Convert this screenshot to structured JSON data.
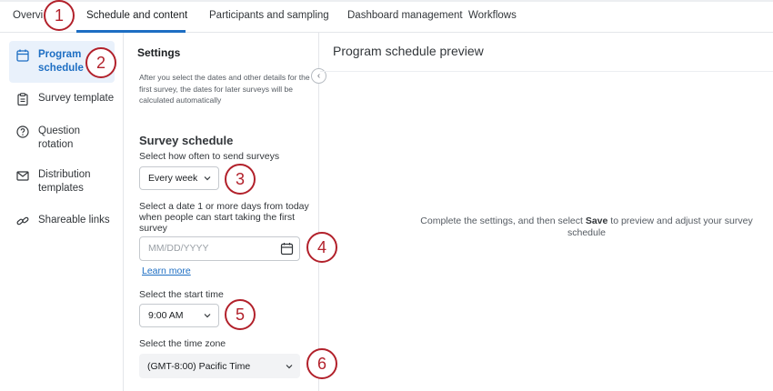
{
  "tabs": [
    {
      "label": "Overvi"
    },
    {
      "label": "Schedule and content"
    },
    {
      "label": "Participants and sampling"
    },
    {
      "label": "Dashboard management"
    },
    {
      "label": "Workflows"
    }
  ],
  "nav": [
    {
      "label": "Program schedule",
      "icon": "calendar-icon"
    },
    {
      "label": "Survey template",
      "icon": "clipboard-icon"
    },
    {
      "label": "Question rotation",
      "icon": "question-circle-icon"
    },
    {
      "label": "Distribution templates",
      "icon": "envelope-icon"
    },
    {
      "label": "Shareable links",
      "icon": "link-icon"
    }
  ],
  "settings": {
    "title": "Settings",
    "intro": "After you select the dates and other details for the first survey, the dates for later surveys will be calculated automatically",
    "schedule_title": "Survey schedule",
    "frequency_label": "Select how often to send surveys",
    "frequency_value": "Every week",
    "date_label": "Select a date 1 or more days from today when people can start taking the first survey",
    "date_placeholder": "MM/DD/YYYY",
    "learn_more": "Learn more",
    "start_label": "Select the start time",
    "start_value": "9:00 AM",
    "tz_label": "Select the time zone",
    "tz_value": "(GMT-8:00) Pacific Time"
  },
  "preview": {
    "title": "Program schedule preview",
    "msg_before": "Complete the settings, and then select ",
    "msg_bold": "Save",
    "msg_after": " to preview and adjust your survey schedule"
  },
  "callouts": [
    "1",
    "2",
    "3",
    "4",
    "5",
    "6"
  ],
  "colors": {
    "accent": "#1d6ec3",
    "callout": "#b2212b"
  }
}
